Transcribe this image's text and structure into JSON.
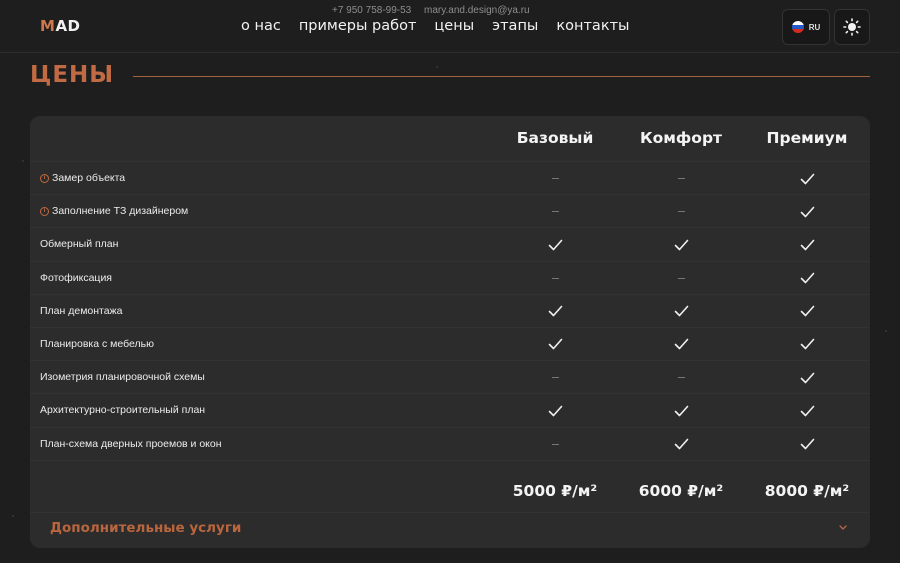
{
  "header": {
    "logo_m": "M",
    "logo_rest": "AD",
    "phone": "+7 950 758-99-53",
    "email": "mary.and.design@ya.ru",
    "nav": [
      "о нас",
      "примеры работ",
      "цены",
      "этапы",
      "контакты"
    ],
    "lang": "RU",
    "icons": {
      "flag": "russia-flag-icon",
      "theme": "sun-icon"
    }
  },
  "section": {
    "title": "ЦЕНЫ"
  },
  "pricing": {
    "plans": [
      "Базовый",
      "Комфорт",
      "Премиум"
    ],
    "rows": [
      {
        "label": "Замер объекта",
        "info": true,
        "values": [
          false,
          false,
          true
        ]
      },
      {
        "label": "Заполнение ТЗ дизайнером",
        "info": true,
        "values": [
          false,
          false,
          true
        ]
      },
      {
        "label": "Обмерный план",
        "info": false,
        "values": [
          true,
          true,
          true
        ]
      },
      {
        "label": "Фотофиксация",
        "info": false,
        "values": [
          false,
          false,
          true
        ]
      },
      {
        "label": "План демонтажа",
        "info": false,
        "values": [
          true,
          true,
          true
        ]
      },
      {
        "label": "Планировка с мебелью",
        "info": false,
        "values": [
          true,
          true,
          true
        ]
      },
      {
        "label": "Изометрия планировочной схемы",
        "info": false,
        "values": [
          false,
          false,
          true
        ]
      },
      {
        "label": "Архитектурно-строительный план",
        "info": false,
        "values": [
          true,
          true,
          true
        ]
      },
      {
        "label": "План-схема дверных проемов и окон",
        "info": false,
        "values": [
          false,
          true,
          true
        ]
      }
    ],
    "prices": [
      "5000 ₽/м²",
      "6000 ₽/м²",
      "8000 ₽/м²"
    ],
    "extra_label": "Дополнительные услуги"
  },
  "colors": {
    "accent": "#c06b43",
    "background": "#1e1e1e",
    "card": "#2c2c2c"
  }
}
